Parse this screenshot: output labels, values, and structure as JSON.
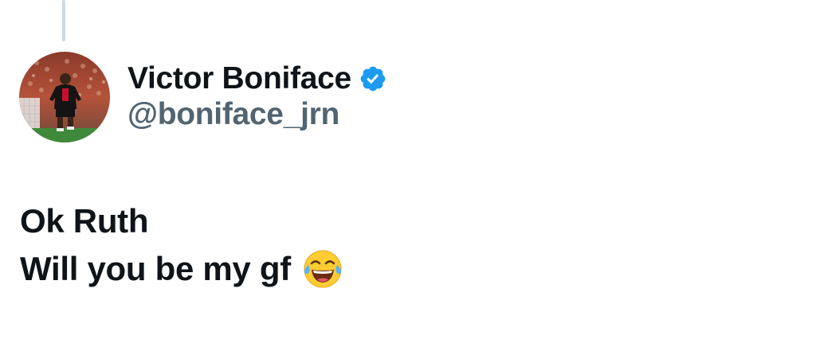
{
  "author": {
    "display_name": "Victor Boniface",
    "handle": "@boniface_jrn",
    "verified": true,
    "verified_color": "#1d9bf0",
    "avatar_icon": "profile-photo-footballer"
  },
  "tweet": {
    "lines": [
      "Ok Ruth",
      "Will you be my gf"
    ],
    "emoji": "face-with-tears-of-joy"
  },
  "colors": {
    "text_primary": "#0f1419",
    "text_secondary": "#536471",
    "thread_line": "#cfd9de"
  }
}
